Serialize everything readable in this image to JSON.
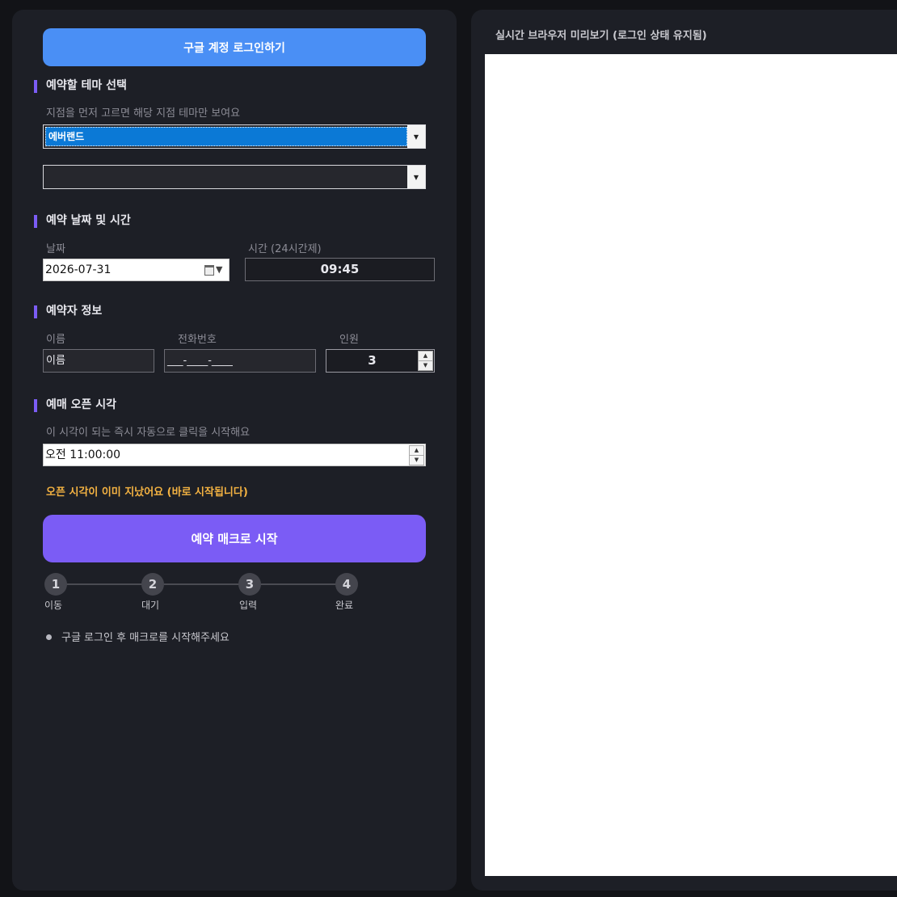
{
  "login": {
    "google_button": "구글 계정 로그인하기"
  },
  "theme": {
    "title": "예약할 테마 선택",
    "hint": "지점을 먼저 고르면 해당 지점 테마만 보여요",
    "branch_value": "에버랜드",
    "theme_value": ""
  },
  "datetime": {
    "title": "예약 날짜 및 시간",
    "date_label": "날짜",
    "date_value": "2026-07-31",
    "time_label": "시간 (24시간제)",
    "time_value": "09:45"
  },
  "booker": {
    "title": "예약자 정보",
    "name_label": "이름",
    "name_value": "이름",
    "phone_label": "전화번호",
    "phone_value": "___-____-____",
    "people_label": "인원",
    "people_value": "3"
  },
  "open": {
    "title": "예매 오픈 시각",
    "hint": "이 시각이 되는 즉시 자동으로 클릭을 시작해요",
    "time_value": "오전 11:00:00",
    "warning": "오픈 시각이 이미 지났어요 (바로 시작됩니다)"
  },
  "macro": {
    "start_button": "예약 매크로 시작"
  },
  "steps": [
    {
      "num": "1",
      "label": "이동"
    },
    {
      "num": "2",
      "label": "대기"
    },
    {
      "num": "3",
      "label": "입력"
    },
    {
      "num": "4",
      "label": "완료"
    }
  ],
  "status_message": "구글 로그인 후 매크로를 시작해주세요",
  "preview": {
    "title": "실시간 브라우저 미리보기 (로그인 상태 유지됨)"
  },
  "colors": {
    "accent_blue": "#4a8ff5",
    "accent_purple": "#7b5cf5",
    "warning": "#f5b342",
    "panel_bg": "#1d1f26"
  },
  "icons": [
    "calendar-icon",
    "dropdown-arrow-icon",
    "spinner-up-icon",
    "spinner-down-icon",
    "status-dot-icon"
  ]
}
